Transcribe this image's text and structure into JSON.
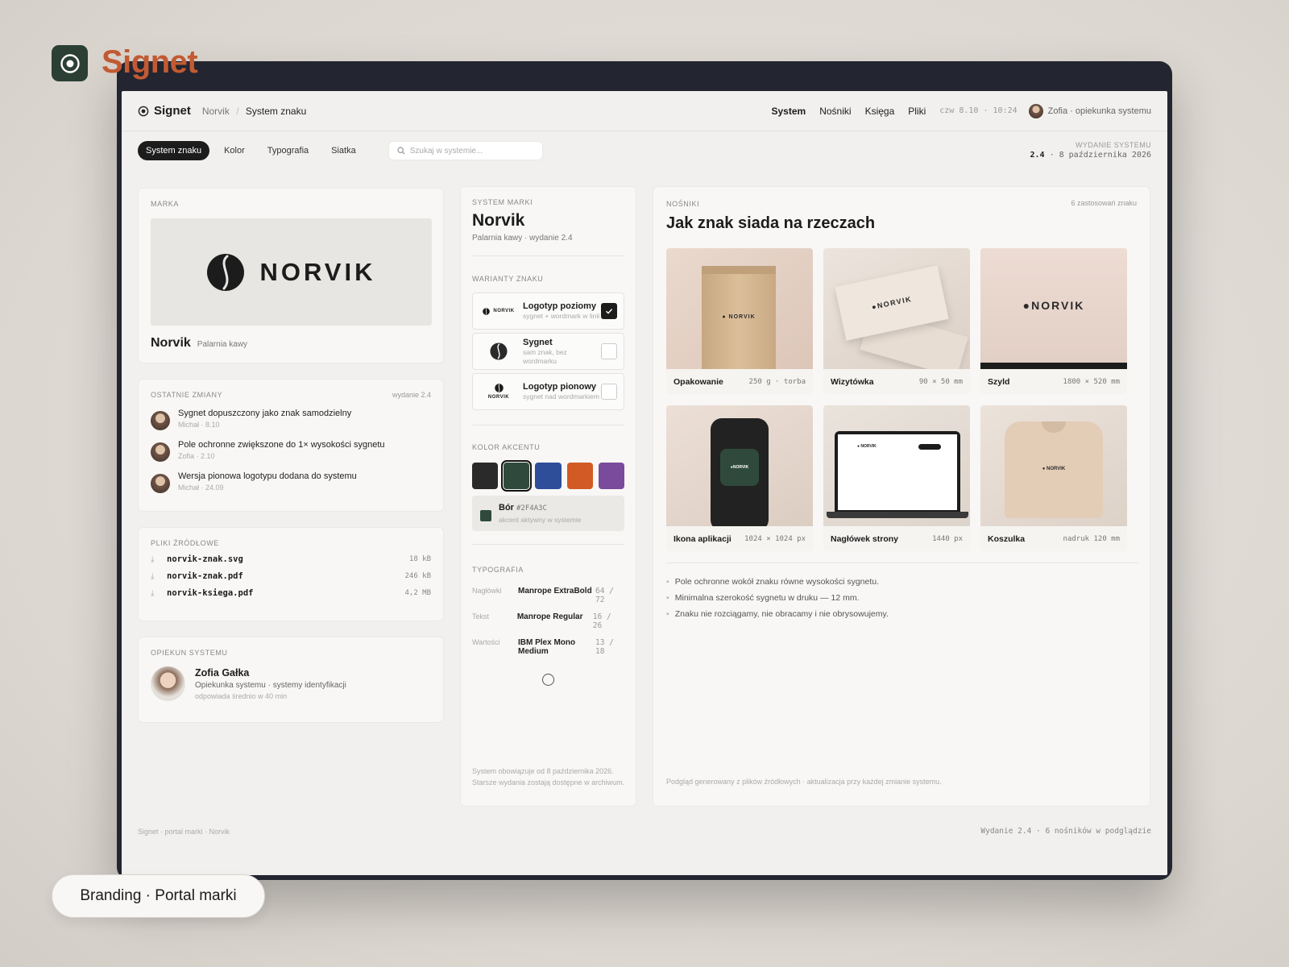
{
  "app": {
    "name": "Signet"
  },
  "nav": {
    "logo": "Signet",
    "crumb_parent": "Norvik",
    "crumb_sep": "/",
    "crumb_current": "System znaku",
    "links": [
      "System",
      "Nośniki",
      "Księga",
      "Pliki"
    ],
    "clock": "czw 8.10 · 10:24",
    "user": "Zofia · opiekunka systemu"
  },
  "toolbar": {
    "tabs": [
      "System znaku",
      "Kolor",
      "Typografia",
      "Siatka"
    ],
    "search_placeholder": "Szukaj w systemie...",
    "release_label": "Wydanie systemu",
    "release_version": "2.4",
    "release_date": "· 8 października 2026"
  },
  "brand_card": {
    "label": "Marka",
    "wordmark": "NORVIK",
    "name": "Norvik",
    "descriptor": "Palarnia kawy"
  },
  "changes": {
    "label": "Ostatnie zmiany",
    "release": "wydanie 2.4",
    "items": [
      {
        "text": "Sygnet dopuszczony jako znak samodzielny",
        "meta": "Michał · 8.10"
      },
      {
        "text": "Pole ochronne zwiększone do 1× wysokości sygnetu",
        "meta": "Zofia · 2.10"
      },
      {
        "text": "Wersja pionowa logotypu dodana do systemu",
        "meta": "Michał · 24.09"
      }
    ]
  },
  "files": {
    "label": "Pliki źródłowe",
    "items": [
      {
        "name": "norvik-znak.svg",
        "size": "18 kB"
      },
      {
        "name": "norvik-znak.pdf",
        "size": "246 kB"
      },
      {
        "name": "norvik-ksiega.pdf",
        "size": "4,2 MB"
      }
    ]
  },
  "owner": {
    "label": "Opiekun systemu",
    "name": "Zofia Gałka",
    "role": "Opiekunka systemu · systemy identyfikacji",
    "response": "odpowiada średnio w 40 min"
  },
  "system": {
    "label": "System marki",
    "title": "Norvik",
    "subtitle": "Palarnia kawy · wydanie 2.4",
    "variants_label": "Warianty znaku",
    "variants": [
      {
        "title": "Logotyp poziomy",
        "sub": "sygnet + wordmark w linii",
        "checked": true
      },
      {
        "title": "Sygnet",
        "sub": "sam znak, bez wordmarku",
        "checked": false
      },
      {
        "title": "Logotyp pionowy",
        "sub": "sygnet nad wordmarkiem",
        "checked": false
      }
    ],
    "mini_word": "NORVIK",
    "accent_label": "Kolor akcentu",
    "swatches": [
      "#2a2a2a",
      "#2f4a3c",
      "#2e4e9a",
      "#d25a25",
      "#7a4a9c"
    ],
    "accent_name": "Bór",
    "accent_hex": "#2F4A3C",
    "accent_note": "akcent aktywny w systemie",
    "typo_label": "Typografia",
    "typo": [
      {
        "key": "Nagłówki",
        "name": "Manrope ExtraBold",
        "metric": "64 / 72"
      },
      {
        "key": "Tekst",
        "name": "Manrope Regular",
        "metric": "16 / 26"
      },
      {
        "key": "Wartości",
        "name": "IBM Plex Mono Medium",
        "metric": "13 / 18"
      }
    ],
    "footnote": "System obowiązuje od 8 października 2026. Starsze wydania zostają dostępne w archiwum."
  },
  "carriers": {
    "label": "Nośniki",
    "title": "Jak znak siada na rzeczach",
    "count": "6 zastosowań znaku",
    "items": [
      {
        "name": "Opakowanie",
        "meta": "250 g · torba"
      },
      {
        "name": "Wizytówka",
        "meta": "90 × 50 mm"
      },
      {
        "name": "Szyld",
        "meta": "1800 × 520 mm"
      },
      {
        "name": "Ikona aplikacji",
        "meta": "1024 × 1024 px"
      },
      {
        "name": "Nagłówek strony",
        "meta": "1440 px"
      },
      {
        "name": "Koszulka",
        "meta": "nadruk 120 mm"
      }
    ],
    "rules": [
      "Pole ochronne wokół znaku równe wysokości sygnetu.",
      "Minimalna szerokość sygnetu w druku — 12 mm.",
      "Znaku nie rozciągamy, nie obracamy i nie obrysowujemy."
    ],
    "footnote": "Podgląd generowany z plików źródłowych · aktualizacja przy każdej zmianie systemu."
  },
  "footer": {
    "left": "Signet · portal marki · Norvik",
    "right": "Wydanie 2.4 · 6 nośników w podglądzie"
  },
  "badge": "Branding · Portal marki"
}
